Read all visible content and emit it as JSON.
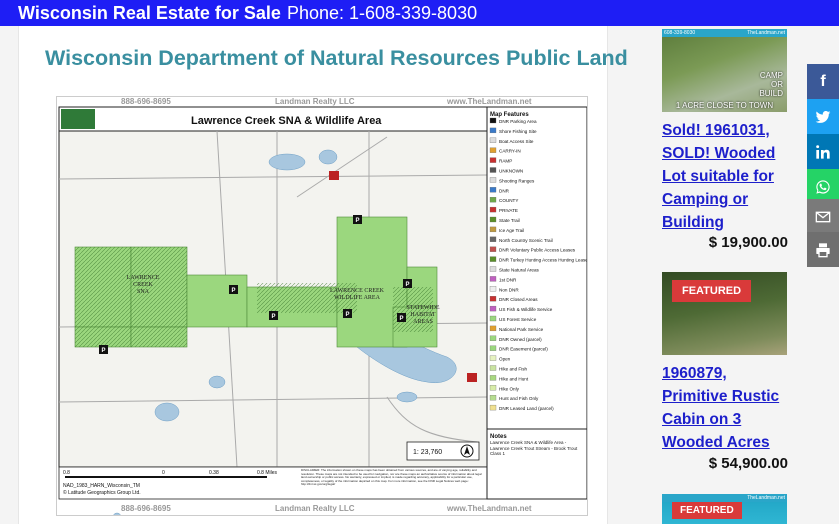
{
  "topbar": {
    "site_name": "Wisconsin Real Estate for Sale",
    "phone": "Phone: 1-608-339-8030"
  },
  "post": {
    "title": "Wisconsin Department of Natural Resources Public Land"
  },
  "map": {
    "header_left": "888-696-8695",
    "header_mid": "Landman Realty LLC",
    "header_right": "www.TheLandman.net",
    "footer_left": "888-696-8695",
    "footer_mid": "Landman Realty LLC",
    "footer_right": "www.TheLandman.net",
    "title": "Lawrence Creek SNA & Wildlife Area",
    "area_label_1a": "LAWRENCE",
    "area_label_1b": "CREEK",
    "area_label_1c": "SNA",
    "area_label_2a": "LAWRENCE CREEK",
    "area_label_2b": "WILDLIFE AREA",
    "area_label_3a": "STATEWIDE",
    "area_label_3b": "HABITAT",
    "area_label_3c": "AREAS",
    "scale": "1: 23,760",
    "scale_0_8": "0.8",
    "scale_0": "0",
    "scale_0_38": "0.38",
    "scale_miles": "0.8 Miles",
    "nad": "NAD_1983_HARN_Wisconsin_TM",
    "copyright": "© Latitude Geographics Group Ltd.",
    "disclaimer": "DISCLAIMER: The information shown on these maps has been obtained from various sources, and are of varying age, reliability and resolution. These maps are not intended to be used for navigation, nor are these maps an authoritative source of information about legal land ownership or public access. No warranty, expressed or implied, is made regarding accuracy, applicability for a particular use, completeness, or legality of the information depicted on this map. For more information, see the DNR Legal Notices web page: http://dnr.wi.gov/org/legal/",
    "notes_title": "Notes",
    "notes_text": "Lawrence Creek SNA & Wildlife Area - Lawrence Creek Trout Stream - Brook Trout Class 1",
    "legend_title": "Map Features",
    "legend_items": [
      "DNR Parking Area",
      "Shore Fishing Site",
      "Boat Access Site",
      "CARRY-IN",
      "RAMP",
      "UNKNOWN",
      "Shooting Ranges",
      "DNR",
      "COUNTY",
      "PRIVATE",
      "State Trail",
      "Ice Age Trail",
      "North Country Scenic Trail",
      "DNR Voluntary Public Access Leases",
      "DNR Turkey Hunting Access Hunting Leases",
      "State Natural Areas",
      "1st DNR",
      "Non DNR",
      "DNR Closed Areas",
      "US Fish & Wildlife Service",
      "US Forest Service",
      "National Park Service",
      "DNR Owned (parcel)",
      "DNR Easement (parcel)",
      "Open",
      "Hike and Fish",
      "Hike and Hunt",
      "Hike Only",
      "Hunt and Fish Only",
      "DNR Leased Land (parcel)"
    ],
    "road_labels": [
      "Lawrence Rd",
      "Eagle Ct",
      "1st Ave",
      "Ember Ln",
      "Eagle Drive"
    ],
    "lake_labels": [
      "Hamlet Lake",
      "Lake",
      "Pilot Lake",
      "Lake"
    ]
  },
  "sidebar": {
    "listings": [
      {
        "thumb_tag": "608-339-8030",
        "thumb_tag_right": "TheLandman.net",
        "thumb_caption_1": "CAMP",
        "thumb_caption_2": "OR",
        "thumb_caption_3": "BUILD",
        "thumb_caption_4": "1 ACRE CLOSE TO TOWN",
        "title": "Sold! 1961031, SOLD! Wooded Lot suitable for Camping or Building",
        "price": "$ 19,900.00"
      },
      {
        "badge": "FEATURED",
        "title": "1960879, Primitive Rustic Cabin on 3 Wooded Acres",
        "price": "$ 54,900.00"
      },
      {
        "badge": "FEATURED",
        "thumb_tag": "TheLandman.net"
      }
    ]
  },
  "share": {
    "facebook": "f"
  },
  "colors": {
    "topbar": "#1e1ef5",
    "title": "#3a8fa0",
    "link": "#1d1fcb",
    "featured": "#d93a3a",
    "facebook": "#3b5998",
    "twitter": "#1da1f2",
    "linkedin": "#0077b5",
    "whatsapp": "#25d366",
    "email": "#7a7a7a",
    "print": "#6f6f6f"
  }
}
